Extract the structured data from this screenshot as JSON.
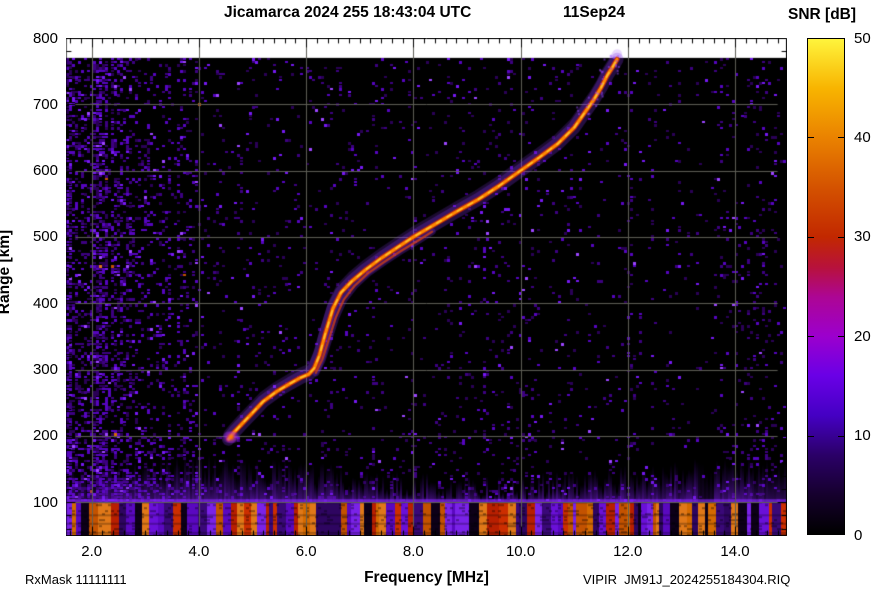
{
  "header": {
    "title": "Jicamarca 2024 255 18:43:04 UTC",
    "date_label": "11Sep24",
    "colorbar_title": "SNR [dB]"
  },
  "footer": {
    "rxmask": "RxMask 11111111",
    "file": "VIPIR  JM91J_2024255184304.RIQ"
  },
  "chart_data": {
    "type": "heatmap",
    "title": "Jicamarca 2024 255 18:43:04 UTC",
    "date_label": "11Sep24",
    "xlabel": "Frequency [MHz]",
    "ylabel": "Range [km]",
    "colorbar_label": "SNR [dB]",
    "xlim": [
      1.52,
      14.97
    ],
    "ylim": [
      49,
      800
    ],
    "x_major_ticks": [
      2,
      4,
      6,
      8,
      10,
      12,
      14
    ],
    "x_tick_labels": [
      "2.0",
      "4.0",
      "6.0",
      "8.0",
      "10.0",
      "12.0",
      "14.0"
    ],
    "x_minor_step": 0.2,
    "y_major_ticks": [
      100,
      200,
      300,
      400,
      500,
      600,
      700,
      800
    ],
    "y_tick_labels": [
      "100",
      "200",
      "300",
      "400",
      "500",
      "600",
      "700",
      "800"
    ],
    "y_minor_step": 20,
    "grid_on": true,
    "grid_color": "#5e5e56",
    "data_top_km": 770,
    "colorbar": {
      "min": 0,
      "max": 50,
      "ticks": [
        0,
        10,
        20,
        30,
        40,
        50
      ],
      "tick_labels": [
        "0",
        "10",
        "20",
        "30",
        "40",
        "50"
      ],
      "inner_ticks": [
        10,
        20,
        30,
        40
      ],
      "stops": [
        {
          "v": 0,
          "c": "#000000"
        },
        {
          "v": 4,
          "c": "#16002e"
        },
        {
          "v": 8,
          "c": "#2b0068"
        },
        {
          "v": 12,
          "c": "#4500c4"
        },
        {
          "v": 16,
          "c": "#6a00e6"
        },
        {
          "v": 20,
          "c": "#9c00cd"
        },
        {
          "v": 24,
          "c": "#ad0693"
        },
        {
          "v": 27,
          "c": "#b8123a"
        },
        {
          "v": 30,
          "c": "#c22800"
        },
        {
          "v": 35,
          "c": "#d45200"
        },
        {
          "v": 40,
          "c": "#ea8200"
        },
        {
          "v": 45,
          "c": "#f8b400"
        },
        {
          "v": 50,
          "c": "#fff43c"
        }
      ]
    },
    "echo_trace": {
      "description": "F-region ionogram echo, SNR ~30-45 dB core",
      "o_mode": [
        [
          4.55,
          195
        ],
        [
          4.65,
          205
        ],
        [
          4.8,
          218
        ],
        [
          5.0,
          235
        ],
        [
          5.2,
          252
        ],
        [
          5.45,
          267
        ],
        [
          5.7,
          279
        ],
        [
          5.9,
          288
        ],
        [
          6.05,
          293
        ],
        [
          6.15,
          302
        ],
        [
          6.25,
          322
        ],
        [
          6.35,
          352
        ],
        [
          6.5,
          392
        ],
        [
          6.65,
          416
        ],
        [
          6.85,
          433
        ],
        [
          7.1,
          450
        ],
        [
          7.4,
          468
        ],
        [
          7.7,
          484
        ],
        [
          8.0,
          500
        ],
        [
          8.4,
          519
        ],
        [
          8.8,
          538
        ],
        [
          9.2,
          556
        ],
        [
          9.6,
          577
        ],
        [
          10.0,
          600
        ],
        [
          10.35,
          620
        ],
        [
          10.7,
          641
        ],
        [
          11.0,
          665
        ],
        [
          11.2,
          688
        ],
        [
          11.35,
          705
        ],
        [
          11.5,
          725
        ],
        [
          11.62,
          744
        ],
        [
          11.73,
          758
        ],
        [
          11.8,
          768
        ]
      ],
      "x_mode": [
        [
          6.18,
          295
        ],
        [
          6.3,
          315
        ],
        [
          6.42,
          345
        ],
        [
          6.55,
          378
        ],
        [
          6.7,
          405
        ],
        [
          6.9,
          426
        ],
        [
          7.15,
          445
        ],
        [
          7.45,
          462
        ],
        [
          7.75,
          478
        ],
        [
          8.1,
          495
        ],
        [
          8.35,
          508
        ]
      ],
      "start_blob": [
        4.6,
        198
      ]
    },
    "noise": {
      "seed": 77431,
      "left_noise_max_mhz": 4.1,
      "dense_edge_mhz": 1.8,
      "quiet_band_mhz": [
        13.3,
        13.6
      ],
      "hot_band_mhz": [
        14.2,
        14.75
      ],
      "interference_band_top_km": 100,
      "haze_top_km": 138,
      "speckle_colors": [
        "#2a0056",
        "#3c0080",
        "#5504be",
        "#7418f0",
        "#9b45ff"
      ],
      "stripe_colors_warm": [
        "#d46a00",
        "#e07818",
        "#c35200",
        "#cc2e00",
        "#b81f00"
      ],
      "stripe_colors_cool": [
        "#6a10d8",
        "#7a22e8",
        "#5a08c0",
        "#2e0560",
        "#3a0878",
        "#0d0018"
      ]
    }
  }
}
